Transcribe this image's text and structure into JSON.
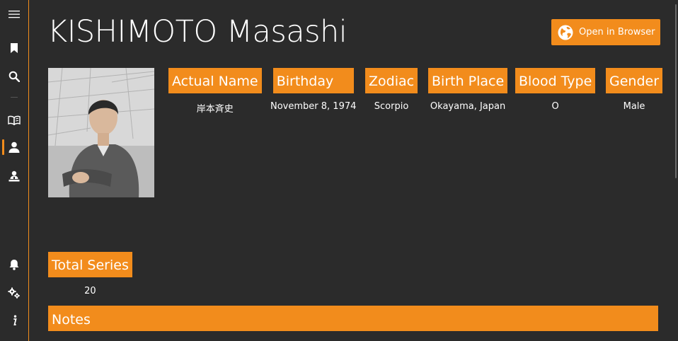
{
  "nav": {
    "items": [
      {
        "icon": "hamburger-menu-icon"
      },
      {
        "icon": "bookmark-icon"
      },
      {
        "icon": "search-icon"
      },
      {
        "icon": "open-book-icon"
      },
      {
        "icon": "person-icon",
        "active": true
      },
      {
        "icon": "people-icon"
      },
      {
        "icon": "bell-icon"
      },
      {
        "icon": "gear-icon"
      },
      {
        "icon": "info-icon"
      }
    ],
    "accent": "#f28c1c"
  },
  "author": {
    "name": "KISHIMOTO Masashi",
    "open_button_label": "Open in Browser",
    "attributes": [
      {
        "label": "Actual Name",
        "value": "岸本斉史"
      },
      {
        "label": "Birthday",
        "value": "November 8, 1974"
      },
      {
        "label": "Zodiac",
        "value": "Scorpio"
      },
      {
        "label": "Birth Place",
        "value": "Okayama, Japan"
      },
      {
        "label": "Blood Type",
        "value": "O"
      },
      {
        "label": "Gender",
        "value": "Male"
      }
    ],
    "total_series": {
      "label": "Total Series",
      "value": "20"
    },
    "notes": {
      "label": "Notes"
    }
  },
  "colors": {
    "background": "#2b2b2b",
    "accent": "#f28c1c",
    "text": "#ffffff"
  }
}
